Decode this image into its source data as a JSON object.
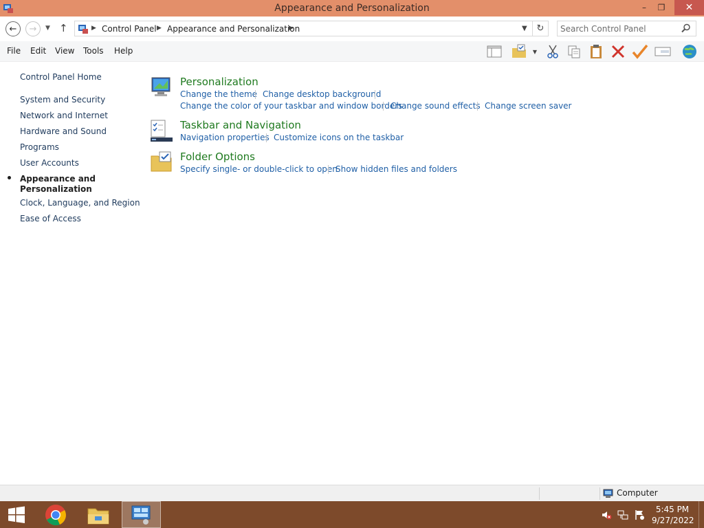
{
  "window": {
    "title": "Appearance and Personalization",
    "controls": {
      "minimize": "–",
      "restore": "❐",
      "close": "✕"
    }
  },
  "address_bar": {
    "back_glyph": "←",
    "forward_glyph": "→",
    "up_glyph": "↑",
    "refresh_glyph": "↻",
    "breadcrumbs": [
      "Control Panel",
      "Appearance and Personalization"
    ],
    "search_placeholder": "Search Control Panel"
  },
  "menu": [
    "File",
    "Edit",
    "View",
    "Tools",
    "Help"
  ],
  "toolbar_icons": [
    "layout-pane-icon",
    "folder-check-icon",
    "dropdown-icon",
    "cut-icon",
    "copy-icon",
    "paste-icon",
    "delete-icon",
    "checkmark-icon",
    "properties-icon",
    "globe-icon"
  ],
  "sidebar": {
    "home": "Control Panel Home",
    "items": [
      "System and Security",
      "Network and Internet",
      "Hardware and Sound",
      "Programs",
      "User Accounts"
    ],
    "current": "Appearance and\nPersonalization",
    "items_after": [
      "Clock, Language, and Region",
      "Ease of Access"
    ]
  },
  "categories": [
    {
      "title": "Personalization",
      "row1": [
        "Change the theme",
        "Change desktop background"
      ],
      "row2": [
        "Change the color of your taskbar and window borders",
        "Change sound effects",
        "Change screen saver"
      ]
    },
    {
      "title": "Taskbar and Navigation",
      "row1": [
        "Navigation properties",
        "Customize icons on the taskbar"
      ]
    },
    {
      "title": "Folder Options",
      "row1": [
        "Specify single- or double-click to open",
        "Show hidden files and folders"
      ]
    }
  ],
  "status_bar": {
    "location": "Computer"
  },
  "taskbar": {
    "apps": [
      "chrome",
      "file-explorer",
      "control-panel"
    ],
    "clock_time": "5:45 PM",
    "clock_date": "9/27/2022"
  },
  "colors": {
    "titlebar": "#e38f6a",
    "taskbar": "#7d4a2b",
    "link": "#1f5fa6",
    "category_title": "#1f7a1f"
  }
}
